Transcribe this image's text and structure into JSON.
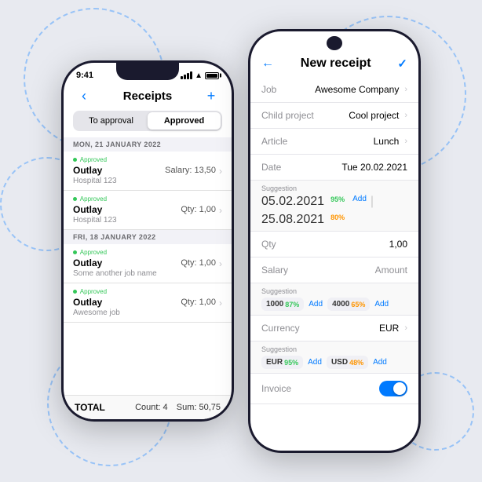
{
  "leftPhone": {
    "statusBar": {
      "time": "9:41",
      "signal": true,
      "wifi": true,
      "battery": true
    },
    "header": {
      "title": "Receipts",
      "backLabel": "‹",
      "addLabel": "+"
    },
    "segments": [
      {
        "label": "To approval",
        "active": false
      },
      {
        "label": "Approved",
        "active": true
      }
    ],
    "sections": [
      {
        "header": "MON, 21 JANUARY 2022",
        "items": [
          {
            "status": "Approved",
            "type": "Outlay",
            "detail_label": "Salary:",
            "detail_value": "13,50",
            "sub": "Hospital 123"
          },
          {
            "status": "Approved",
            "type": "Outlay",
            "detail_label": "Qty:",
            "detail_value": "1,00",
            "sub": "Hospital 123"
          }
        ]
      },
      {
        "header": "FRI, 18 JANUARY 2022",
        "items": [
          {
            "status": "Approved",
            "type": "Outlay",
            "detail_label": "Qty:",
            "detail_value": "1,00",
            "sub": "Some another job name"
          },
          {
            "status": "Approved",
            "type": "Outlay",
            "detail_label": "Qty:",
            "detail_value": "1,00",
            "sub": "Awesome job"
          }
        ]
      }
    ],
    "total": {
      "label": "TOTAL",
      "count": "Count: 4",
      "sum": "Sum: 50,75"
    }
  },
  "rightPhone": {
    "header": {
      "title": "New receipt",
      "backLabel": "←",
      "confirmLabel": "✓"
    },
    "fields": [
      {
        "label": "Job",
        "value": "Awesome Company",
        "hasChevron": true
      },
      {
        "label": "Child project",
        "value": "Cool project",
        "hasChevron": true
      },
      {
        "label": "Article",
        "value": "Lunch",
        "hasChevron": true
      },
      {
        "label": "Date",
        "value": "Tue  20.02.2021",
        "hasChevron": false
      }
    ],
    "dateSuggestion": {
      "label": "Suggestion",
      "items": [
        {
          "date": "05.02.2021",
          "pct": "95%",
          "pctClass": "green"
        },
        {
          "add": "Add"
        },
        {
          "date": "25.08.2021",
          "pct": "80%",
          "pctClass": "orange"
        }
      ]
    },
    "qty": {
      "label": "Qty",
      "value": "1,00"
    },
    "salary": {
      "label": "Salary",
      "value": "Amount"
    },
    "salarySuggestion": {
      "label": "Suggestion",
      "items": [
        {
          "val": "1000",
          "pct": "87%",
          "pctClass": "green",
          "add": "Add"
        },
        {
          "val": "4000",
          "pct": "65%",
          "pctClass": "orange",
          "add": "Add"
        }
      ]
    },
    "currency": {
      "label": "Currency",
      "value": "EUR",
      "hasChevron": true
    },
    "currencySuggestion": {
      "label": "Suggestion",
      "items": [
        {
          "val": "EUR",
          "pct": "95%",
          "pctClass": "green",
          "add": "Add"
        },
        {
          "val": "USD",
          "pct": "48%",
          "pctClass": "orange",
          "add": "Add"
        }
      ]
    },
    "invoice": {
      "label": "Invoice",
      "toggled": true
    }
  }
}
